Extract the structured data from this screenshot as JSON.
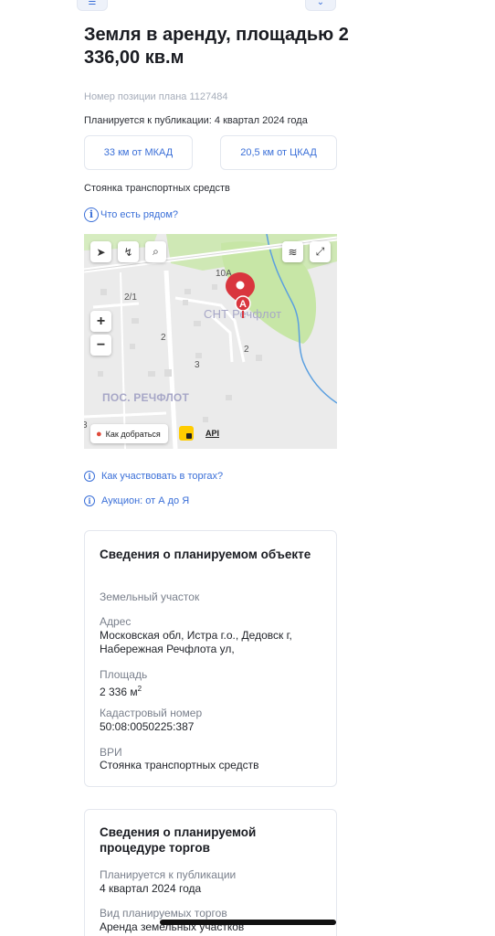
{
  "header": {
    "title": "Земля в аренду, площадью 2 336,00 кв.м"
  },
  "plan": {
    "position_number": "Номер позиции плана 1127484",
    "publication": "Планируется к публикации: 4 квартал 2024 года"
  },
  "distances": {
    "mkad": "33 км от МКАД",
    "ckad": "20,5 км от ЦКАД"
  },
  "vri": "Стоянка транспортных средств",
  "links": {
    "nearby": "Что есть рядом?",
    "how_to_participate": "Как участвовать в торгах?",
    "auction_az": "Аукцион: от А до Я"
  },
  "map": {
    "marker_letter": "A",
    "labels": {
      "snt": "СНТ Речфлот",
      "settlement": "ПОС. РЕЧФЛОТ",
      "n10a": "10А",
      "n21": "2/1",
      "n2a": "2",
      "n2b": "2",
      "n3": "3",
      "n3b": "3"
    },
    "route_button": "Как добраться",
    "api": "API",
    "zoom_in": "+",
    "zoom_out": "−"
  },
  "planned_object": {
    "title": "Сведения о планируемом объекте",
    "type": "Земельный участок",
    "address_label": "Адрес",
    "address_value": "Московская обл, Истра г.о., Дедовск г, Набережная Речфлота ул,",
    "area_label": "Площадь",
    "area_value": "2 336 м",
    "area_sup": "2",
    "cadastral_label": "Кадастровый номер",
    "cadastral_value": "50:08:0050225:387",
    "vri_label": "ВРИ",
    "vri_value": "Стоянка транспортных средств"
  },
  "planned_procedure": {
    "title": "Сведения о планируемой процедуре торгов",
    "publication_label": "Планируется к публикации",
    "publication_value": "4 квартал 2024 года",
    "type_label": "Вид планируемых торгов",
    "type_value": "Аренда земельных участков"
  },
  "colors": {
    "accent": "#3a6fd8",
    "marker": "#d9363e",
    "map_green": "#c8e6a8",
    "river": "#5a9fe0"
  }
}
